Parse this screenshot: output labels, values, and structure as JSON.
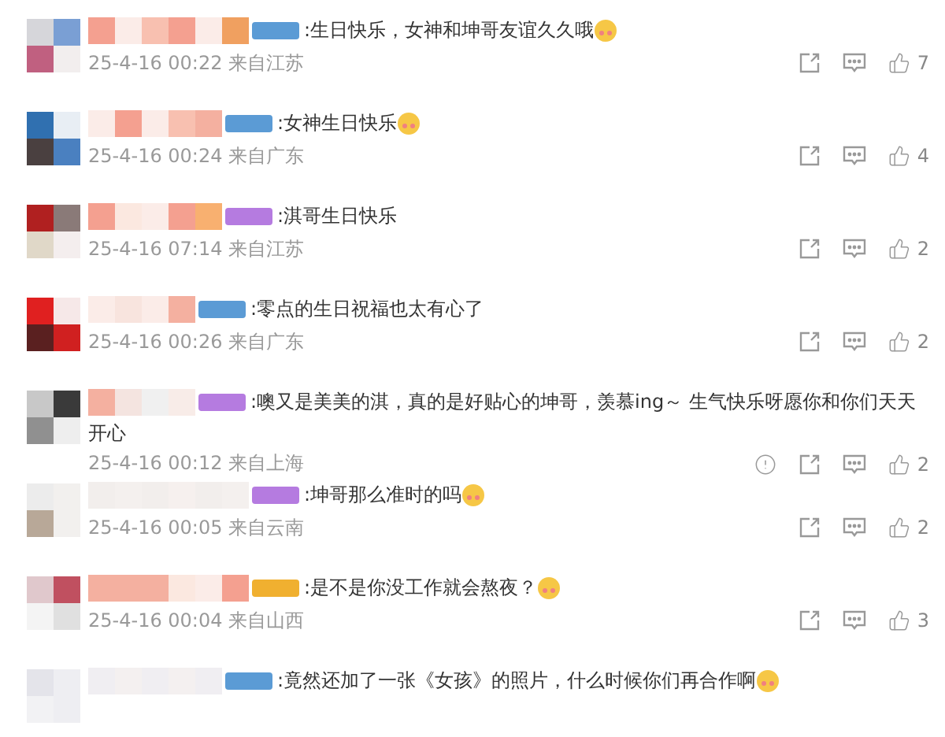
{
  "comments": [
    {
      "color": "#5b9bd5",
      "text": ":生日快乐，女神和坤哥友谊久久哦",
      "emoji": true,
      "time": "25-4-16 00:22",
      "source": "来自江苏",
      "report": false,
      "likes": "7"
    },
    {
      "color": "#5b9bd5",
      "text": ":女神生日快乐",
      "emoji": true,
      "time": "25-4-16 00:24",
      "source": "来自广东",
      "report": false,
      "likes": "4"
    },
    {
      "color": "#b57be0",
      "text": ":淇哥生日快乐",
      "emoji": false,
      "time": "25-4-16 07:14",
      "source": "来自江苏",
      "report": false,
      "likes": "2"
    },
    {
      "color": "#5b9bd5",
      "text": ":零点的生日祝福也太有心了",
      "emoji": false,
      "time": "25-4-16 00:26",
      "source": "来自广东",
      "report": false,
      "likes": "2"
    },
    {
      "color": "#b57be0",
      "text": ":噢又是美美的淇，真的是好贴心的坤哥，羡慕ing～ 生气快乐呀愿你和你们天天",
      "text_cont": "开心",
      "emoji": false,
      "time": "25-4-16 00:12",
      "source": "来自上海",
      "report": true,
      "likes": "2"
    },
    {
      "color": "#b57be0",
      "text": ":坤哥那么准时的吗",
      "emoji": true,
      "time": "25-4-16 00:05",
      "source": "来自云南",
      "report": false,
      "likes": "2"
    },
    {
      "color": "#f0b030",
      "text": ":是不是你没工作就会熬夜？",
      "emoji": true,
      "time": "25-4-16 00:04",
      "source": "来自山西",
      "report": false,
      "likes": "3"
    },
    {
      "color": "#5b9bd5",
      "text": ":竟然还加了一张《女孩》的照片，什么时候你们再合作啊",
      "emoji": true
    }
  ]
}
